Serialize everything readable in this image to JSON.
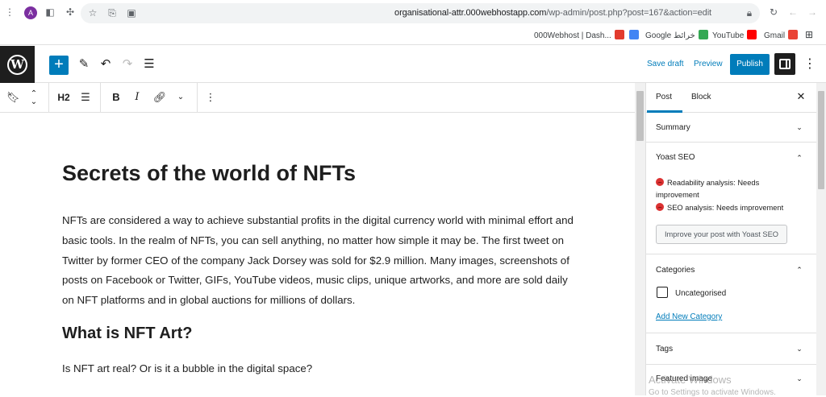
{
  "browser": {
    "profile_initial": "A",
    "url_host": "organisational-attr.000webhostapp.com",
    "url_path": "/wp-admin/post.php?post=167&action=edit",
    "icons": [
      "more-vert-icon",
      "sidebar-icon",
      "extensions-icon",
      "star-icon",
      "tab-search-icon",
      "cast-icon",
      "lock-icon",
      "reload-icon",
      "back-icon",
      "forward-icon"
    ]
  },
  "bookmarks": [
    {
      "label": "000Webhost | Dash...",
      "icon": "webhost-favicon",
      "color": "#e23b2e"
    },
    {
      "label": "",
      "icon": "docs-favicon",
      "color": "#4285f4"
    },
    {
      "label": "Google خرائط",
      "icon": "maps-favicon",
      "color": "#34a853"
    },
    {
      "label": "YouTube",
      "icon": "youtube-favicon",
      "color": "#ff0000"
    },
    {
      "label": "Gmail",
      "icon": "gmail-favicon",
      "color": "#ea4335"
    },
    {
      "label": "",
      "icon": "apps-grid-icon",
      "color": "#5f6368"
    }
  ],
  "wp_toolbar": {
    "save_draft": "Save draft",
    "preview": "Preview",
    "publish": "Publish",
    "accent": "#007cba"
  },
  "block_toolbar": {
    "heading_level": "H2"
  },
  "editor": {
    "title": "Secrets of the world of NFTs",
    "paragraph1": "NFTs are considered a way to achieve substantial profits in the digital currency world with minimal effort and basic tools. In the realm of NFTs, you can sell anything, no matter how simple it may be. The first tweet on Twitter by former CEO of the company Jack Dorsey was sold for $2.9 million. Many images, screenshots of posts on Facebook or Twitter, GIFs, YouTube videos, music clips, unique artworks, and more are sold daily on NFT platforms and in global auctions for millions of dollars.",
    "heading2": "What is NFT Art?",
    "paragraph2": "Is NFT art real? Or is it a bubble in the digital space?"
  },
  "sidebar": {
    "tab_post": "Post",
    "tab_block": "Block",
    "summary": "Summary",
    "yoast_title": "Yoast SEO",
    "readability_label": "Readability analysis:",
    "readability_value": "Needs improvement",
    "seo_label": "SEO analysis:",
    "seo_value": "Needs improvement",
    "yoast_button": "Improve your post with Yoast SEO",
    "categories": "Categories",
    "uncategorised": "Uncategorised",
    "add_category": "Add New Category",
    "tags": "Tags",
    "featured_image": "Featured image"
  },
  "watermark": {
    "line1": "Activate Windows",
    "line2": "Go to Settings to activate Windows."
  }
}
